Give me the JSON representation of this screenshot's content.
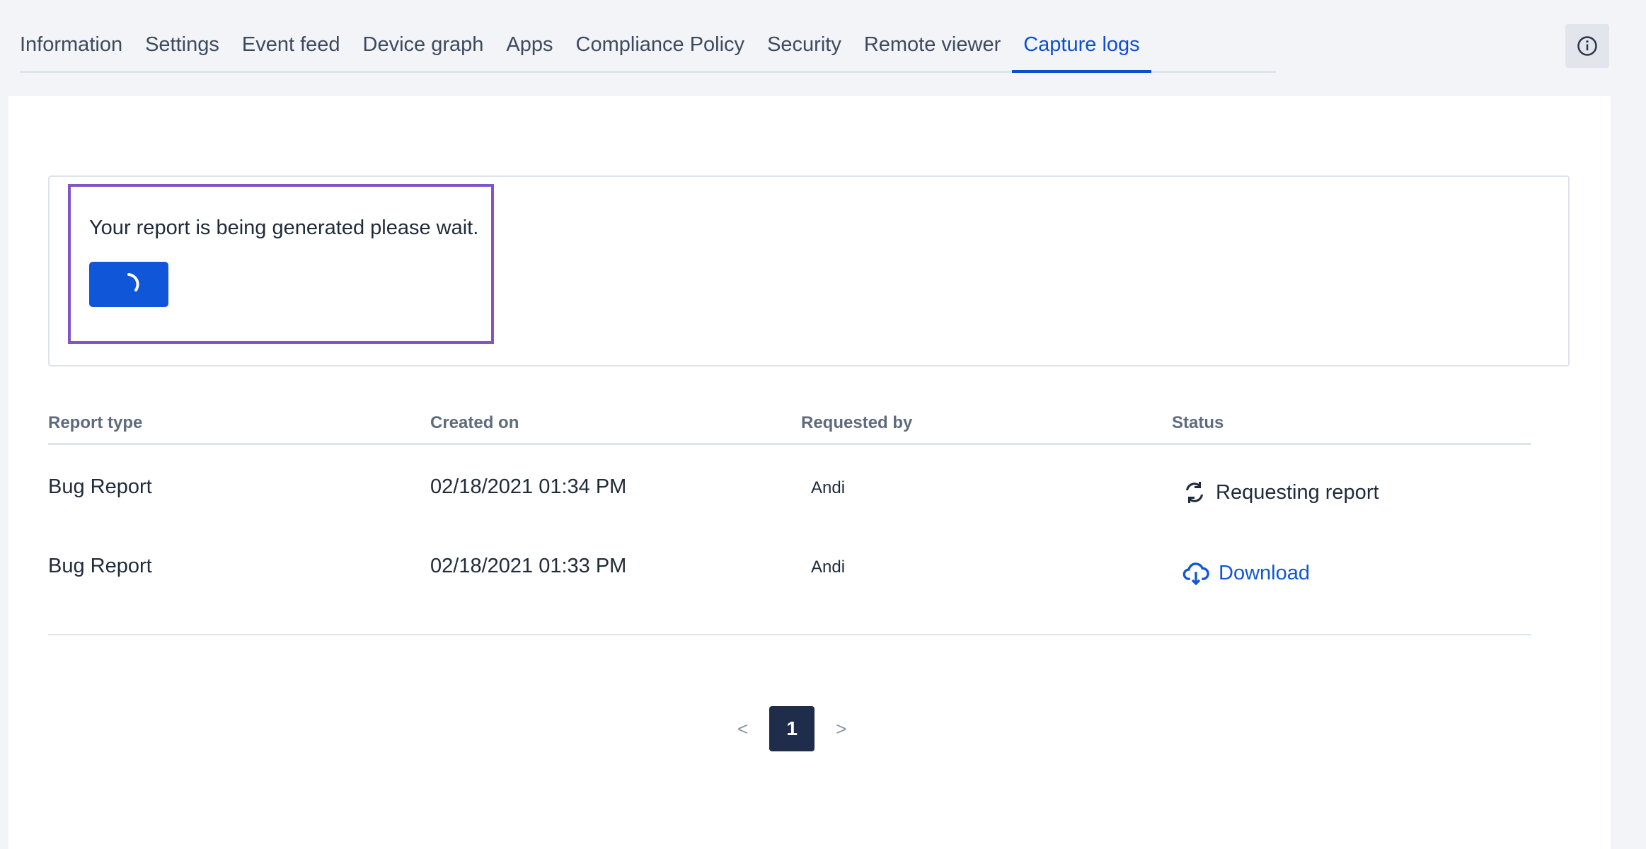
{
  "tabs": [
    {
      "label": "Information"
    },
    {
      "label": "Settings"
    },
    {
      "label": "Event feed"
    },
    {
      "label": "Device graph"
    },
    {
      "label": "Apps"
    },
    {
      "label": "Compliance Policy"
    },
    {
      "label": "Security"
    },
    {
      "label": "Remote viewer"
    },
    {
      "label": "Capture logs"
    }
  ],
  "active_tab": "Capture logs",
  "info_button": {
    "icon": "info-icon"
  },
  "notice": {
    "message": "Your report is being generated please wait.",
    "button_icon": "spinner-icon"
  },
  "table": {
    "headers": {
      "report_type": "Report type",
      "created_on": "Created on",
      "requested_by": "Requested by",
      "status": "Status"
    },
    "rows": [
      {
        "report_type": "Bug Report",
        "created_on": "02/18/2021 01:34 PM",
        "requested_by": "Andi",
        "status": "Requesting report",
        "status_icon": "refresh-icon"
      },
      {
        "report_type": "Bug Report",
        "created_on": "02/18/2021 01:33 PM",
        "requested_by": "Andi",
        "status": "Download",
        "status_icon": "cloud-download-icon"
      }
    ]
  },
  "pagination": {
    "prev": "<",
    "current": "1",
    "next": ">"
  },
  "colors": {
    "accent": "#0f56d8",
    "highlight": "#8155c8",
    "pager_active": "#1f2c4a"
  }
}
